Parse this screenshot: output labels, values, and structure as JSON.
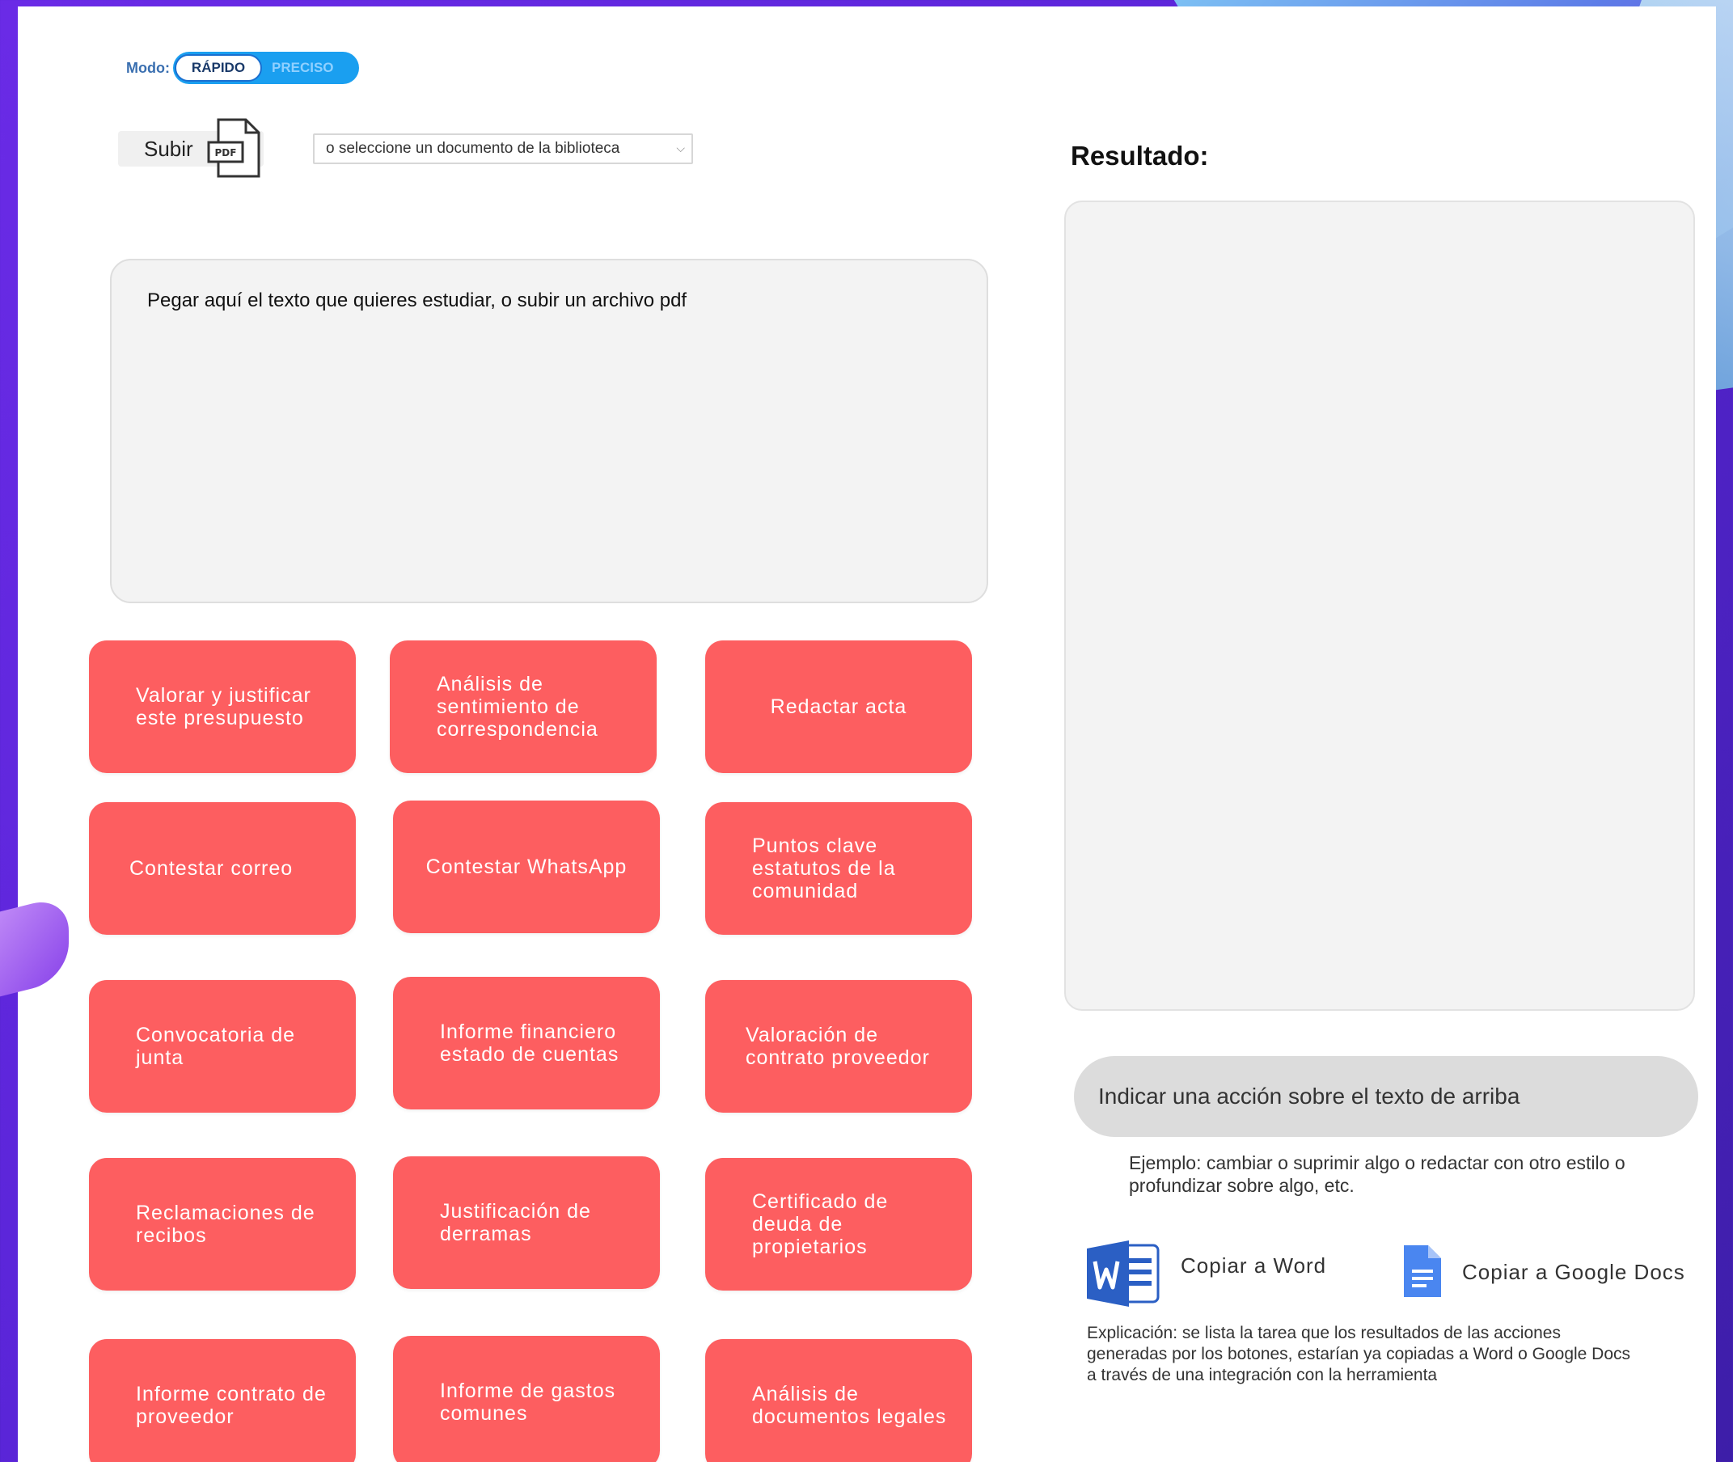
{
  "mode": {
    "label": "Modo:",
    "options": [
      "RÁPIDO",
      "PRECISO"
    ],
    "selected": "RÁPIDO"
  },
  "upload": {
    "button_label": "Subir",
    "pdf_icon_text": "PDF",
    "library_select_value": "o seleccione un documento de la biblioteca"
  },
  "input": {
    "placeholder": "Pegar aquí el texto que quieres estudiar, o subir un archivo pdf"
  },
  "actions": [
    "Valorar y justificar este presupuesto",
    "Análisis de sentimiento de correspondencia",
    "Redactar acta",
    "Contestar correo",
    "Contestar WhatsApp",
    "Puntos clave estatutos de la comunidad",
    "Convocatoria de junta",
    "Informe financiero estado de cuentas",
    "Valoración de contrato proveedor",
    "Reclamaciones de recibos",
    "Justificación de derramas",
    "Certificado de deuda de propietarios",
    "Informe contrato de proveedor",
    "Informe de gastos comunes",
    "Análisis de documentos legales"
  ],
  "result": {
    "title": "Resultado:"
  },
  "action_input": {
    "placeholder": "Indicar una acción sobre el texto de arriba"
  },
  "example_text": "Ejemplo: cambiar o suprimir algo o redactar con otro estilo o profundizar sobre algo, etc.",
  "copy": {
    "word_label": "Copiar a Word",
    "gdocs_label": "Copiar a Google Docs"
  },
  "explanation": "Explicación: se lista la tarea que los resultados de las acciones generadas por los botones, estarían ya copiadas a Word o Google Docs a través de una integración con la herramienta",
  "colors": {
    "action_button": "#fd5e60",
    "toggle": "#1a9ff0",
    "word_blue": "#2b5fc4",
    "gdocs_blue": "#4a86f0"
  }
}
